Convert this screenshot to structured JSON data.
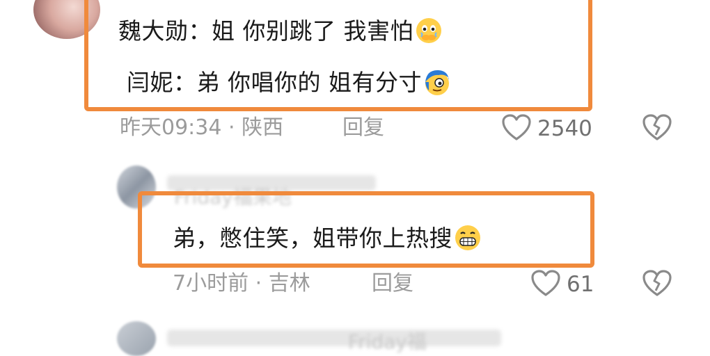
{
  "comments": [
    {
      "lines": [
        {
          "speaker": "魏大勋：",
          "text": "姐 你别跳了 我害怕",
          "emoji": "fearful-face-emoji"
        },
        {
          "speaker": "闫妮：",
          "text": "弟 你唱你的 姐有分寸",
          "emoji": "blue-hair-face-emoji"
        }
      ],
      "time": "昨天09:34",
      "separator": "·",
      "location": "陕西",
      "reply_label": "回复",
      "likes": "2540"
    },
    {
      "username": "Friday福果地",
      "text": "弟，憋住笑，姐带你上热搜",
      "emoji": "grinning-face-emoji",
      "time": "7小时前",
      "separator": "·",
      "location": "吉林",
      "reply_label": "回复",
      "likes": "61"
    },
    {
      "username": "Friday福"
    }
  ],
  "colors": {
    "highlight_border": "#f08a3c",
    "meta_text": "#9b9b9b",
    "main_text": "#1a1a1a"
  }
}
